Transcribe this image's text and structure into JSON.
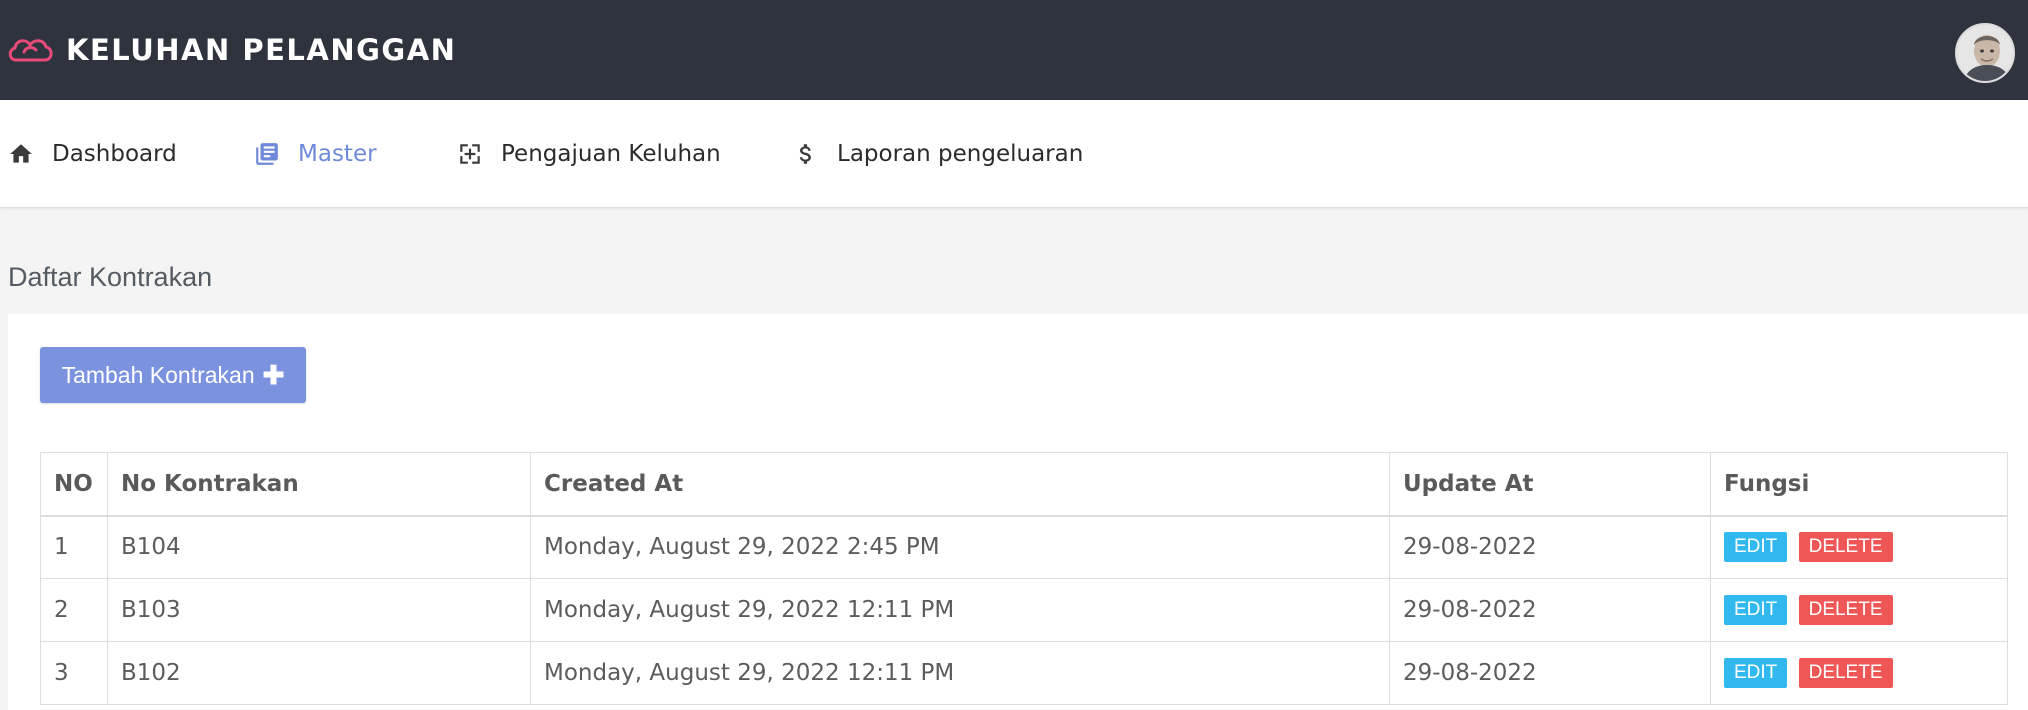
{
  "header": {
    "app_title": "KELUHAN PELANGGAN",
    "logo_icon": "cloud-outline-icon",
    "logo_color": "#e84a7a",
    "avatar_icon": "user-avatar"
  },
  "nav": {
    "items": [
      {
        "label": "Dashboard",
        "icon": "home-icon",
        "active": false
      },
      {
        "label": "Master",
        "icon": "library-books-icon",
        "active": true
      },
      {
        "label": "Pengajuan Keluhan",
        "icon": "add-box-icon",
        "active": false
      },
      {
        "label": "Laporan pengeluaran",
        "icon": "dollar-icon",
        "active": false
      }
    ],
    "active_color": "#6f8ad8"
  },
  "page": {
    "title": "Daftar Kontrakan",
    "add_button_label": "Tambah Kontrakan",
    "add_button_icon": "plus-icon"
  },
  "table": {
    "columns": [
      "NO",
      "No Kontrakan",
      "Created At",
      "Update At",
      "Fungsi"
    ],
    "edit_label": "EDIT",
    "delete_label": "DELETE",
    "rows": [
      {
        "no": "1",
        "no_kontrakan": "B104",
        "created_at": "Monday, August 29, 2022 2:45 PM",
        "update_at": "29-08-2022"
      },
      {
        "no": "2",
        "no_kontrakan": "B103",
        "created_at": "Monday, August 29, 2022 12:11 PM",
        "update_at": "29-08-2022"
      },
      {
        "no": "3",
        "no_kontrakan": "B102",
        "created_at": "Monday, August 29, 2022 12:11 PM",
        "update_at": "29-08-2022"
      }
    ]
  }
}
